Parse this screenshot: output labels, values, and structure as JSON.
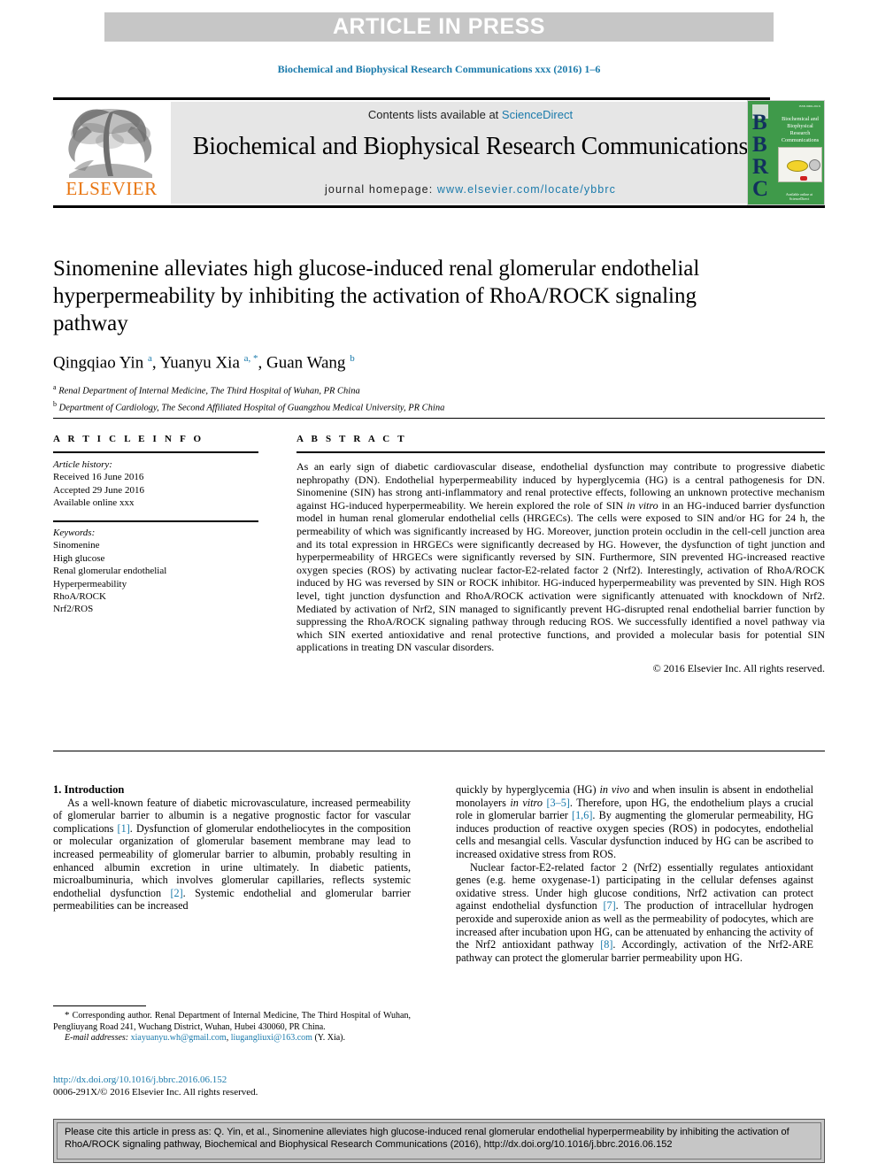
{
  "banner": {
    "text": "ARTICLE IN PRESS"
  },
  "running_head": "Biochemical and Biophysical Research Communications xxx (2016) 1–6",
  "journal_header": {
    "contents_prefix": "Contents lists available at ",
    "sciencedirect": "ScienceDirect",
    "journal_title": "Biochemical and Biophysical Research Communications",
    "homepage_label": "journal homepage: ",
    "homepage_url": "www.elsevier.com/locate/ybbrc",
    "publisher": "ELSEVIER",
    "cover": {
      "letters": "BBRC",
      "title": "Biochemical and Biophysical Research Communications"
    },
    "colors": {
      "link": "#1a7aab",
      "elsevier_orange": "#e87511",
      "cover_green": "#3f9a4a",
      "cover_blue": "#12305e",
      "banner_gray": "#c6c6c6"
    }
  },
  "article": {
    "title": "Sinomenine alleviates high glucose-induced renal glomerular endothelial hyperpermeability by inhibiting the activation of RhoA/ROCK signaling pathway",
    "authors_html": "Qingqiao Yin <sup>a</sup>, Yuanyu Xia <sup>a, *</sup>, Guan Wang <sup>b</sup>",
    "affiliations": [
      {
        "marker": "a",
        "text": "Renal Department of Internal Medicine, The Third Hospital of Wuhan, PR China"
      },
      {
        "marker": "b",
        "text": "Department of Cardiology, The Second Affiliated Hospital of Guangzhou Medical University, PR China"
      }
    ]
  },
  "headings": {
    "article_info": "A R T I C L E   I N F O",
    "abstract": "A B S T R A C T"
  },
  "article_info": {
    "history_label": "Article history:",
    "history": [
      "Received 16 June 2016",
      "Accepted 29 June 2016",
      "Available online xxx"
    ],
    "keywords_label": "Keywords:",
    "keywords": [
      "Sinomenine",
      "High glucose",
      "Renal glomerular endothelial",
      "Hyperpermeability",
      "RhoA/ROCK",
      "Nrf2/ROS"
    ]
  },
  "abstract": {
    "text_html": "As an early sign of diabetic cardiovascular disease, endothelial dysfunction may contribute to progressive diabetic nephropathy (DN). Endothelial hyperpermeability induced by hyperglycemia (HG) is a central pathogenesis for DN. Sinomenine (SIN) has strong anti-inflammatory and renal protective effects, following an unknown protective mechanism against HG-induced hyperpermeability. We herein explored the role of SIN <i>in vitro</i> in an HG-induced barrier dysfunction model in human renal glomerular endothelial cells (HRGECs). The cells were exposed to SIN and/or HG for 24 h, the permeability of which was significantly increased by HG. Moreover, junction protein occludin in the cell-cell junction area and its total expression in HRGECs were significantly decreased by HG. However, the dysfunction of tight junction and hyperpermeability of HRGECs were significantly reversed by SIN. Furthermore, SIN prevented HG-increased reactive oxygen species (ROS) by activating nuclear factor-E2-related factor 2 (Nrf2). Interestingly, activation of RhoA/ROCK induced by HG was reversed by SIN or ROCK inhibitor. HG-induced hyperpermeability was prevented by SIN. High ROS level, tight junction dysfunction and RhoA/ROCK activation were significantly attenuated with knockdown of Nrf2. Mediated by activation of Nrf2, SIN managed to significantly prevent HG-disrupted renal endothelial barrier function by suppressing the RhoA/ROCK signaling pathway through reducing ROS. We successfully identified a novel pathway via which SIN exerted antioxidative and renal protective functions, and provided a molecular basis for potential SIN applications in treating DN vascular disorders.",
    "copyright": "© 2016 Elsevier Inc. All rights reserved."
  },
  "body": {
    "section_title": "1.  Introduction",
    "left_paragraphs_html": [
      "As a well-known feature of diabetic microvasculature, increased permeability of glomerular barrier to albumin is a negative prognostic factor for vascular complications <span class=\"ref\">[1]</span>. Dysfunction of glomerular endotheliocytes in the composition or molecular organization of glomerular basement membrane may lead to increased permeability of glomerular barrier to albumin, probably resulting in enhanced albumin excretion in urine ultimately. In diabetic patients, microalbuminuria, which involves glomerular capillaries, reflects systemic endothelial dysfunction <span class=\"ref\">[2]</span>. Systemic endothelial and glomerular barrier permeabilities can be increased"
    ],
    "right_paragraphs_html": [
      "quickly by hyperglycemia (HG) <i>in vivo</i> and when insulin is absent in endothelial monolayers <i>in vitro</i> <span class=\"ref\">[3–5]</span>. Therefore, upon HG, the endothelium plays a crucial role in glomerular barrier <span class=\"ref\">[1,6]</span>. By augmenting the glomerular permeability, HG induces production of reactive oxygen species (ROS) in podocytes, endothelial cells and mesangial cells. Vascular dysfunction induced by HG can be ascribed to increased oxidative stress from ROS.",
      "Nuclear factor-E2-related factor 2 (Nrf2) essentially regulates antioxidant genes (e.g. heme oxygenase-1) participating in the cellular defenses against oxidative stress. Under high glucose conditions, Nrf2 activation can protect against endothelial dysfunction <span class=\"ref\">[7]</span>. The production of intracellular hydrogen peroxide and superoxide anion as well as the permeability of podocytes, which are increased after incubation upon HG, can be attenuated by enhancing the activity of the Nrf2 antioxidant pathway <span class=\"ref\">[8]</span>. Accordingly, activation of the Nrf2-ARE pathway can protect the glomerular barrier permeability upon HG."
    ]
  },
  "footnote": {
    "corresponding_html": "<span style=\"font-size:11px\">*</span> Corresponding author. Renal Department of Internal Medicine, The Third Hospital of Wuhan, Pengliuyang Road 241, Wuchang District, Wuhan, Hubei 430060, PR China.",
    "email_label": "E-mail addresses:",
    "emails": [
      "xiayuanyu.wh@gmail.com",
      "liugangliuxi@163.com"
    ],
    "email_attribution": "(Y. Xia).",
    "doi_url": "http://dx.doi.org/10.1016/j.bbrc.2016.06.152",
    "issn_line": "0006-291X/© 2016 Elsevier Inc. All rights reserved."
  },
  "citation_box": {
    "text": "Please cite this article in press as: Q. Yin, et al., Sinomenine alleviates high glucose-induced renal glomerular endothelial hyperpermeability by inhibiting the activation of RhoA/ROCK signaling pathway, Biochemical and Biophysical Research Communications (2016), http://dx.doi.org/10.1016/j.bbrc.2016.06.152"
  }
}
